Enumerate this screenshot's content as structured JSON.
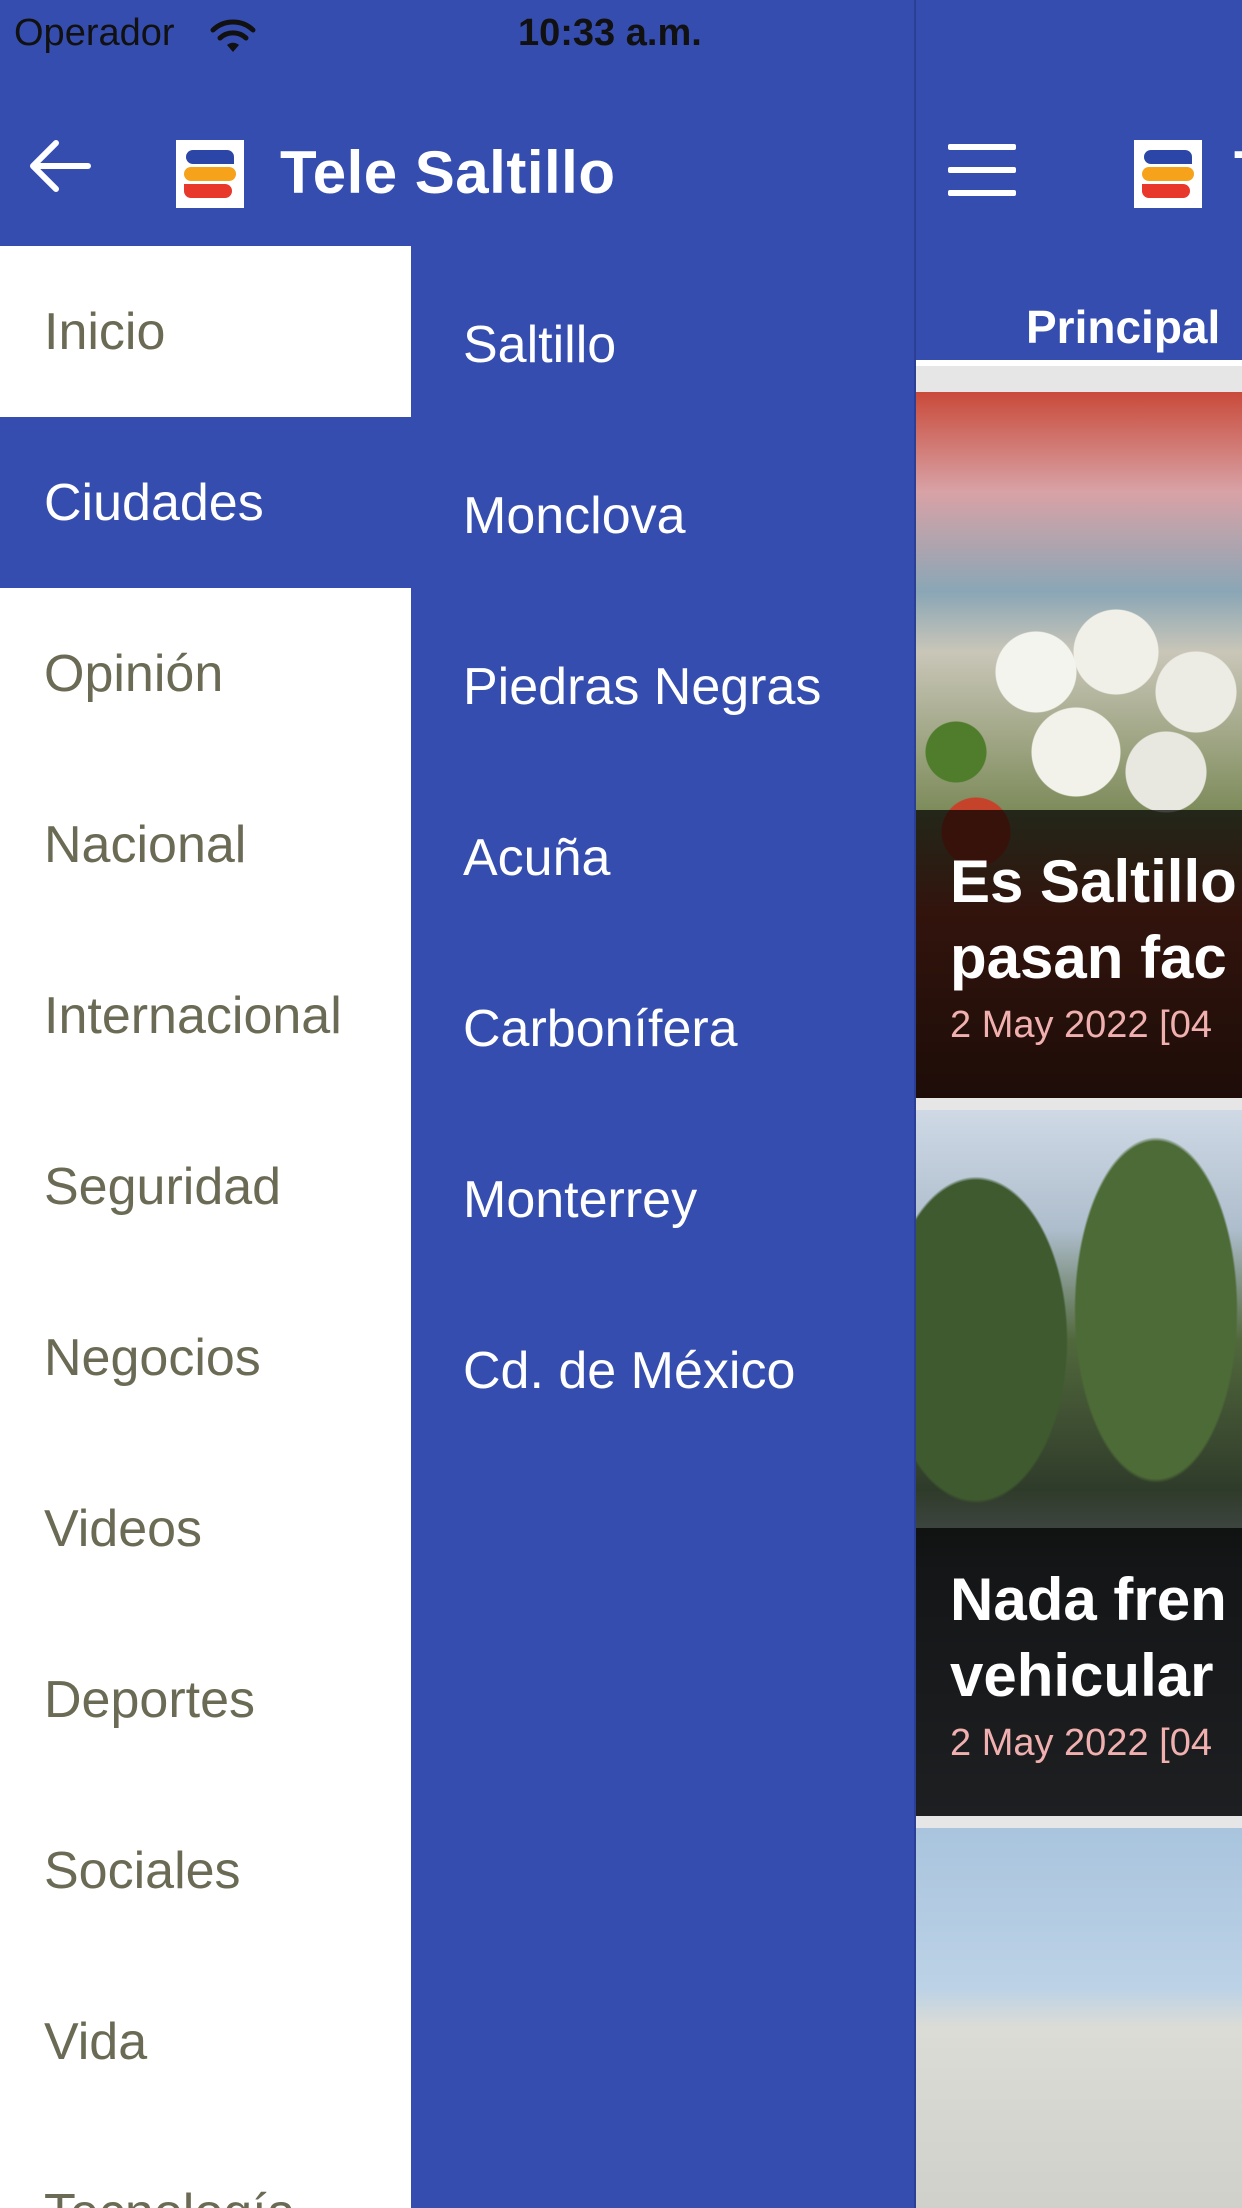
{
  "status_bar": {
    "carrier": "Operador",
    "time": "10:33 a.m."
  },
  "drawer": {
    "app_title": "Tele Saltillo",
    "categories": [
      {
        "label": "Inicio",
        "selected": false
      },
      {
        "label": "Ciudades",
        "selected": true
      },
      {
        "label": "Opinión",
        "selected": false
      },
      {
        "label": "Nacional",
        "selected": false
      },
      {
        "label": "Internacional",
        "selected": false
      },
      {
        "label": "Seguridad",
        "selected": false
      },
      {
        "label": "Negocios",
        "selected": false
      },
      {
        "label": "Videos",
        "selected": false
      },
      {
        "label": "Deportes",
        "selected": false
      },
      {
        "label": "Sociales",
        "selected": false
      },
      {
        "label": "Vida",
        "selected": false
      },
      {
        "label": "Tecnología",
        "selected": false
      }
    ],
    "cities": [
      "Saltillo",
      "Monclova",
      "Piedras Negras",
      "Acuña",
      "Carbonífera",
      "Monterrey",
      "Cd. de México"
    ]
  },
  "main": {
    "title_peek": "T",
    "tab_principal": "Principal",
    "articles": [
      {
        "title_line1": "Es Saltillo",
        "title_line2": "pasan fac",
        "date": "2 May 2022 [04"
      },
      {
        "title_line1": "Nada fren",
        "title_line2": "vehicular",
        "date": "2 May 2022 [04"
      }
    ]
  },
  "colors": {
    "primary": "#354DAF",
    "caption_date": "#F1B0B0",
    "category_text": "#6A6A55"
  }
}
